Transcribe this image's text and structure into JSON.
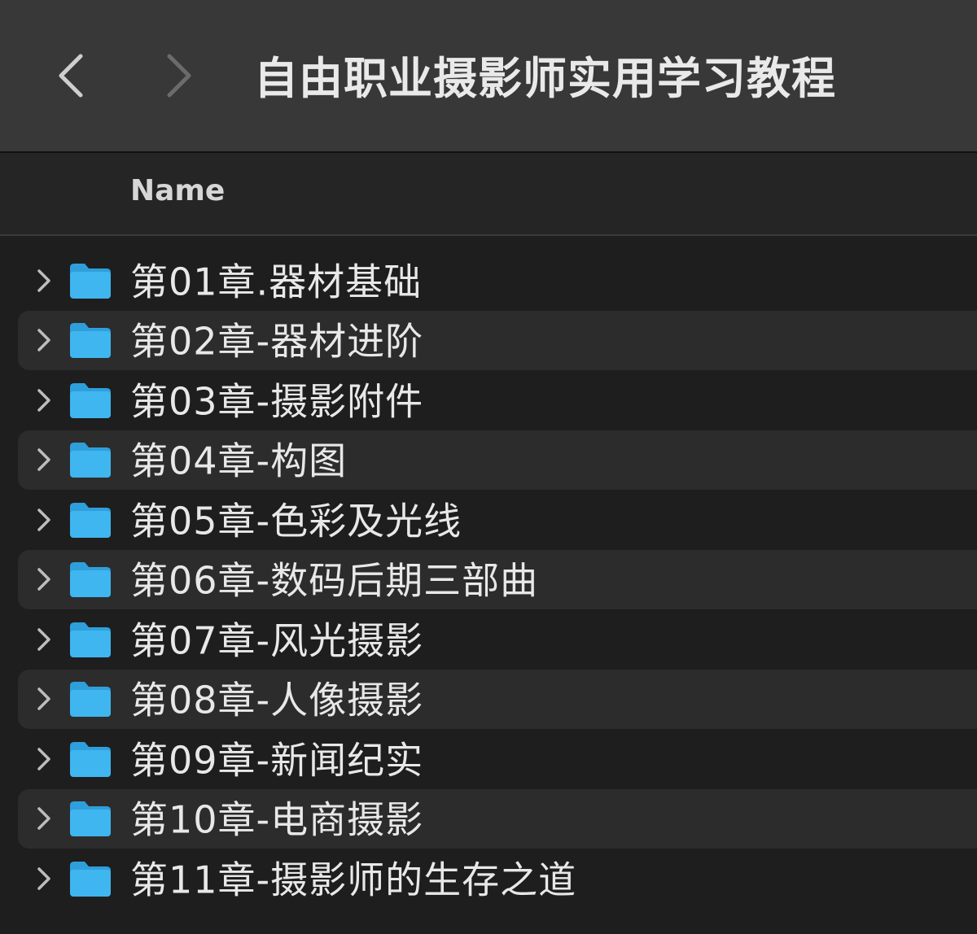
{
  "window": {
    "title": "自由职业摄影师实用学习教程"
  },
  "toolbar": {
    "back_icon": "chevron-left-icon",
    "forward_icon": "chevron-right-icon"
  },
  "columns": {
    "name": "Name"
  },
  "items": [
    {
      "label": "第01章.器材基础",
      "icon": "folder-icon"
    },
    {
      "label": "第02章-器材进阶",
      "icon": "folder-icon"
    },
    {
      "label": "第03章-摄影附件",
      "icon": "folder-icon"
    },
    {
      "label": "第04章-构图",
      "icon": "folder-icon"
    },
    {
      "label": "第05章-色彩及光线",
      "icon": "folder-icon"
    },
    {
      "label": "第06章-数码后期三部曲",
      "icon": "folder-icon"
    },
    {
      "label": "第07章-风光摄影",
      "icon": "folder-icon"
    },
    {
      "label": "第08章-人像摄影",
      "icon": "folder-icon"
    },
    {
      "label": "第09章-新闻纪实",
      "icon": "folder-icon"
    },
    {
      "label": "第10章-电商摄影",
      "icon": "folder-icon"
    },
    {
      "label": "第11章-摄影师的生存之道",
      "icon": "folder-icon"
    }
  ],
  "colors": {
    "folder": "#3fb6ef",
    "folder_tab": "#2f9fdc",
    "background": "#1e1e1e",
    "row_alt": "#2c2c2c",
    "toolbar": "#383838"
  }
}
